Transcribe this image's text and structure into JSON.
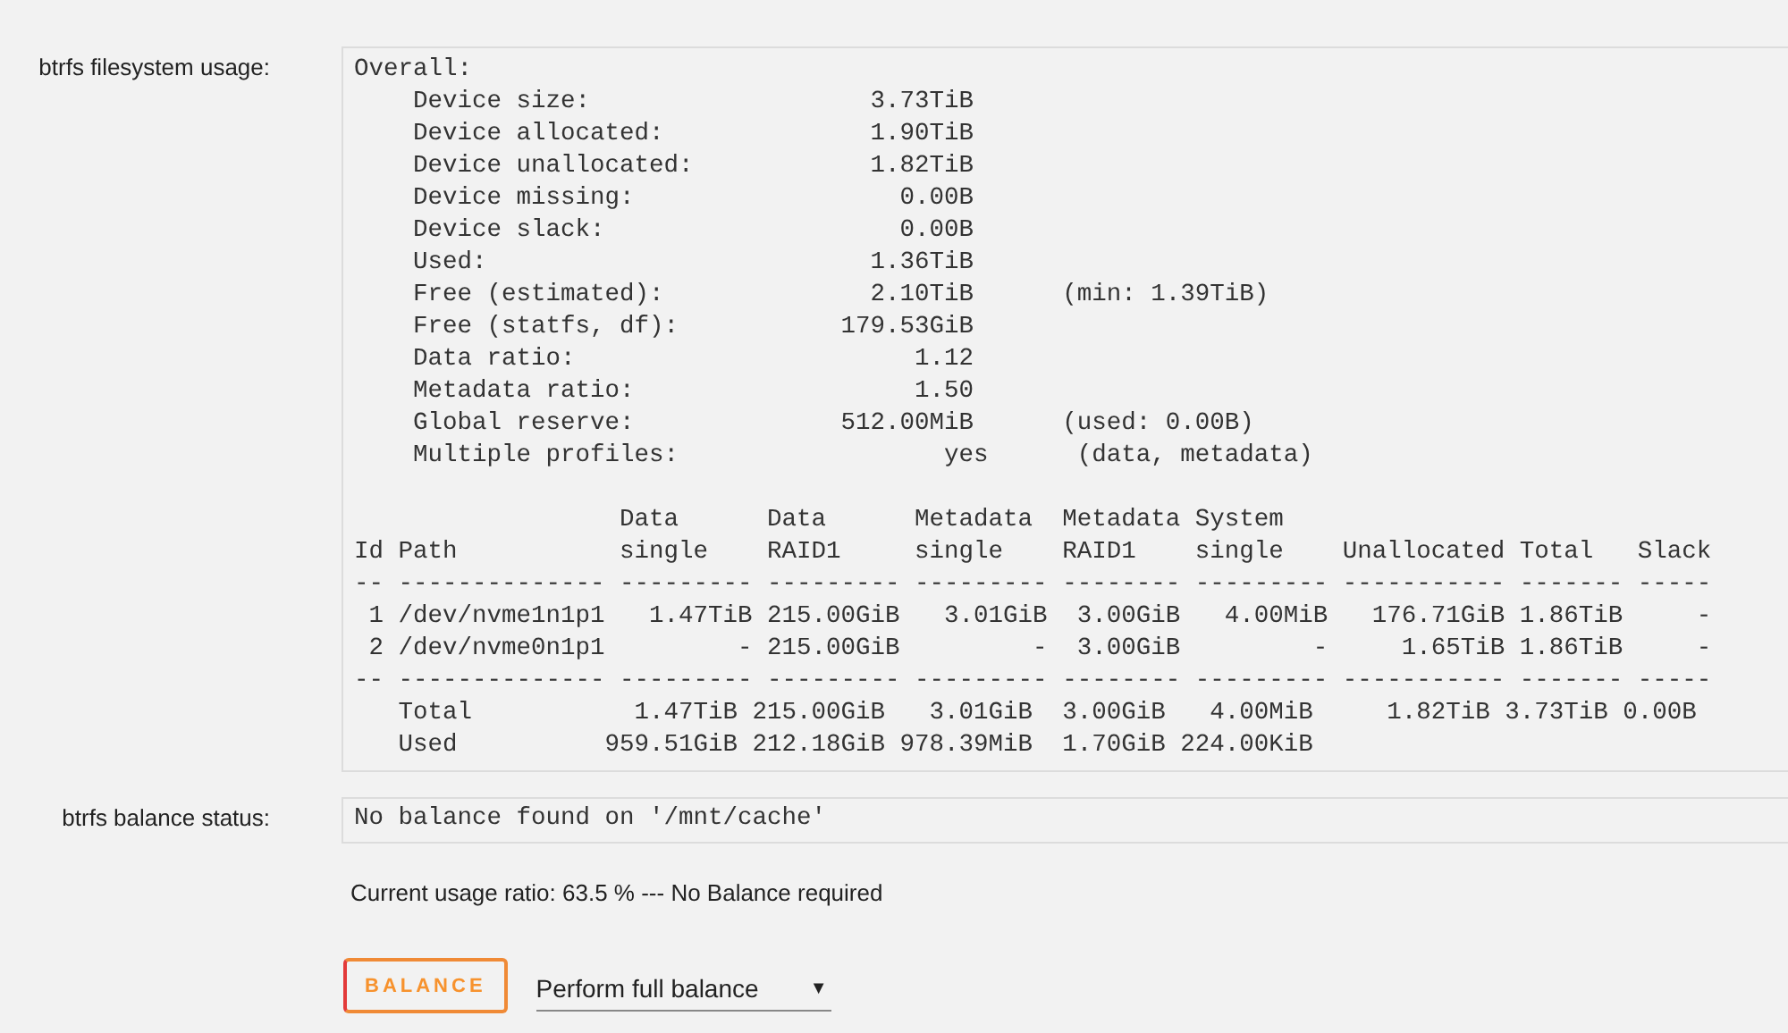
{
  "usage": {
    "label": "btrfs filesystem usage:",
    "overall_lines": [
      "Overall:",
      "    Device size:                   3.73TiB",
      "    Device allocated:              1.90TiB",
      "    Device unallocated:            1.82TiB",
      "    Device missing:                  0.00B",
      "    Device slack:                    0.00B",
      "    Used:                          1.36TiB",
      "    Free (estimated):              2.10TiB      (min: 1.39TiB)",
      "    Free (statfs, df):           179.53GiB",
      "    Data ratio:                       1.12",
      "    Metadata ratio:                   1.50",
      "    Global reserve:              512.00MiB      (used: 0.00B)",
      "    Multiple profiles:                  yes      (data, metadata)"
    ],
    "table_lines": [
      "                  Data      Data      Metadata  Metadata System",
      "Id Path           single    RAID1     single    RAID1    single    Unallocated Total   Slack",
      "-- -------------- --------- --------- --------- -------- --------- ----------- ------- -----",
      " 1 /dev/nvme1n1p1   1.47TiB 215.00GiB   3.01GiB  3.00GiB   4.00MiB   176.71GiB 1.86TiB     -",
      " 2 /dev/nvme0n1p1         - 215.00GiB         -  3.00GiB         -     1.65TiB 1.86TiB     -",
      "-- -------------- --------- --------- --------- -------- --------- ----------- ------- -----",
      "   Total           1.47TiB 215.00GiB   3.01GiB  3.00GiB   4.00MiB     1.82TiB 3.73TiB 0.00B",
      "   Used          959.51GiB 212.18GiB 978.39MiB  1.70GiB 224.00KiB"
    ]
  },
  "balance_status": {
    "label": "btrfs balance status:",
    "value": "No balance found on '/mnt/cache'"
  },
  "usage_ratio": "Current usage ratio: 63.5 % --- No Balance required",
  "balance_button": {
    "label": "BALANCE"
  },
  "balance_mode": {
    "value": "Perform full balance",
    "caret": "▼"
  }
}
